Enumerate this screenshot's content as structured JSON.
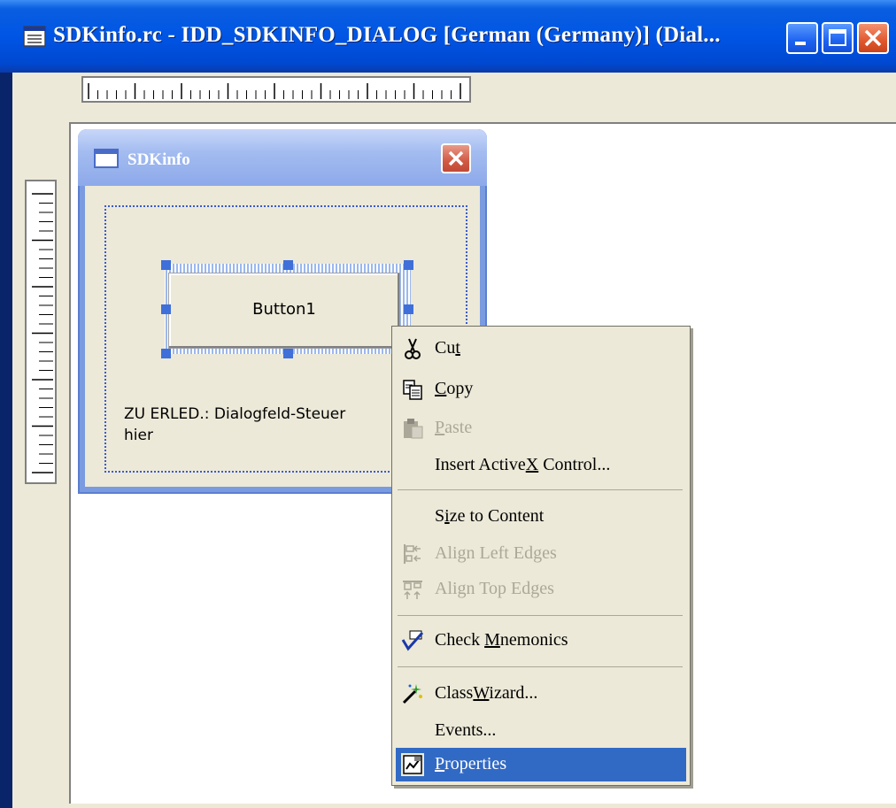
{
  "window": {
    "title": "SDKinfo.rc - IDD_SDKINFO_DIALOG [German (Germany)] (Dial...",
    "icon": "dialog-resource-icon",
    "controls": [
      "minimize-icon",
      "maximize-icon",
      "close-icon"
    ]
  },
  "dialog": {
    "title": "SDKinfo",
    "button_label": "Button1",
    "static_text_line1": "ZU ERLED.: Dialogfeld-Steuer",
    "static_text_line2": "hier"
  },
  "context_menu": {
    "items": [
      {
        "label": "Cut",
        "pre": "Cu",
        "accel": "t",
        "post": "",
        "icon": "scissors-icon",
        "enabled": true
      },
      {
        "label": "Copy",
        "pre": "",
        "accel": "C",
        "post": "opy",
        "icon": "copy-icon",
        "enabled": true
      },
      {
        "label": "Paste",
        "pre": "",
        "accel": "P",
        "post": "aste",
        "icon": "paste-icon",
        "enabled": false
      },
      {
        "label": "Insert ActiveX Control...",
        "pre": "Insert Active",
        "accel": "X",
        "post": " Control...",
        "icon": "",
        "enabled": true
      },
      {
        "label": "Size to Content",
        "pre": "S",
        "accel": "i",
        "post": "ze to Content",
        "icon": "",
        "enabled": true
      },
      {
        "label": "Align Left Edges",
        "pre": "Align Left Edges",
        "accel": "",
        "post": "",
        "icon": "align-left-icon",
        "enabled": false
      },
      {
        "label": "Align Top Edges",
        "pre": "Align Top Edges",
        "accel": "",
        "post": "",
        "icon": "align-top-icon",
        "enabled": false
      },
      {
        "label": "Check Mnemonics",
        "pre": "Check ",
        "accel": "M",
        "post": "nemonics",
        "icon": "check-mnemonics-icon",
        "enabled": true
      },
      {
        "label": "ClassWizard...",
        "pre": "Class",
        "accel": "W",
        "post": "izard...",
        "icon": "wizard-wand-icon",
        "enabled": true
      },
      {
        "label": "Events...",
        "pre": "Events...",
        "accel": "",
        "post": "",
        "icon": "",
        "enabled": true
      },
      {
        "label": "Properties",
        "pre": "",
        "accel": "P",
        "post": "roperties",
        "icon": "properties-icon",
        "enabled": true,
        "selected": true
      }
    ]
  },
  "colors": {
    "title_blue": "#0055e5",
    "menu_highlight": "#316ac5",
    "menu_bg": "#ece9d8",
    "selection_handle": "#3f6fd8"
  }
}
